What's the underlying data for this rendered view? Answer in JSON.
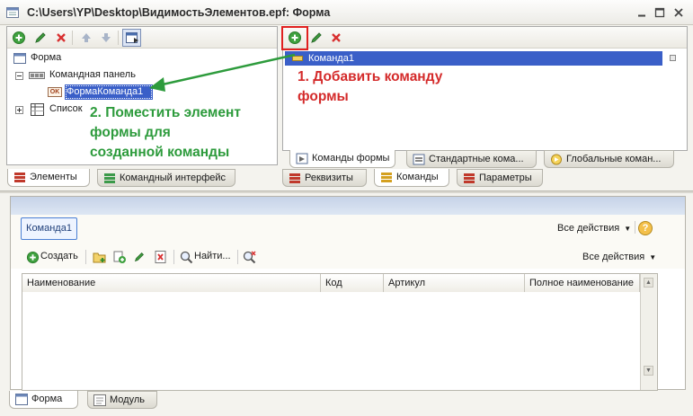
{
  "window": {
    "title": "C:\\Users\\YP\\Desktop\\ВидимостьЭлементов.epf: Форма"
  },
  "left_panel": {
    "tree": {
      "root": "Форма",
      "command_panel": "Командная панель",
      "button_badge": "OK",
      "form_command": "ФормаКоманда1",
      "list": "Список"
    },
    "tabs": [
      "Элементы",
      "Командный интерфейс"
    ]
  },
  "right_panel": {
    "command_item": "Команда1",
    "tabs": [
      "Команды формы",
      "Стандартные кома...",
      "Глобальные коман..."
    ],
    "bottom_tabs": [
      "Реквизиты",
      "Команды",
      "Параметры"
    ]
  },
  "annotations": {
    "step1_line1": "1. Добавить команду",
    "step1_line2": "формы",
    "step2_line1": "2. Поместить элемент",
    "step2_line2": "формы для",
    "step2_line3": "созданной команды"
  },
  "preview": {
    "command_button": "Команда1",
    "all_actions_top": "Все действия",
    "help_label": "?",
    "create_label": "Создать",
    "find_label": "Найти...",
    "all_actions_second": "Все действия",
    "columns": [
      "Наименование",
      "Код",
      "Артикул",
      "Полное наименование"
    ]
  },
  "bottom_tabs": [
    "Форма",
    "Модуль"
  ],
  "colors": {
    "selection": "#3a5fc8",
    "annotation_red": "#d42a2a",
    "annotation_green": "#2d9b3c",
    "add_icon": "#3fa13f",
    "delete_icon": "#d83030"
  }
}
